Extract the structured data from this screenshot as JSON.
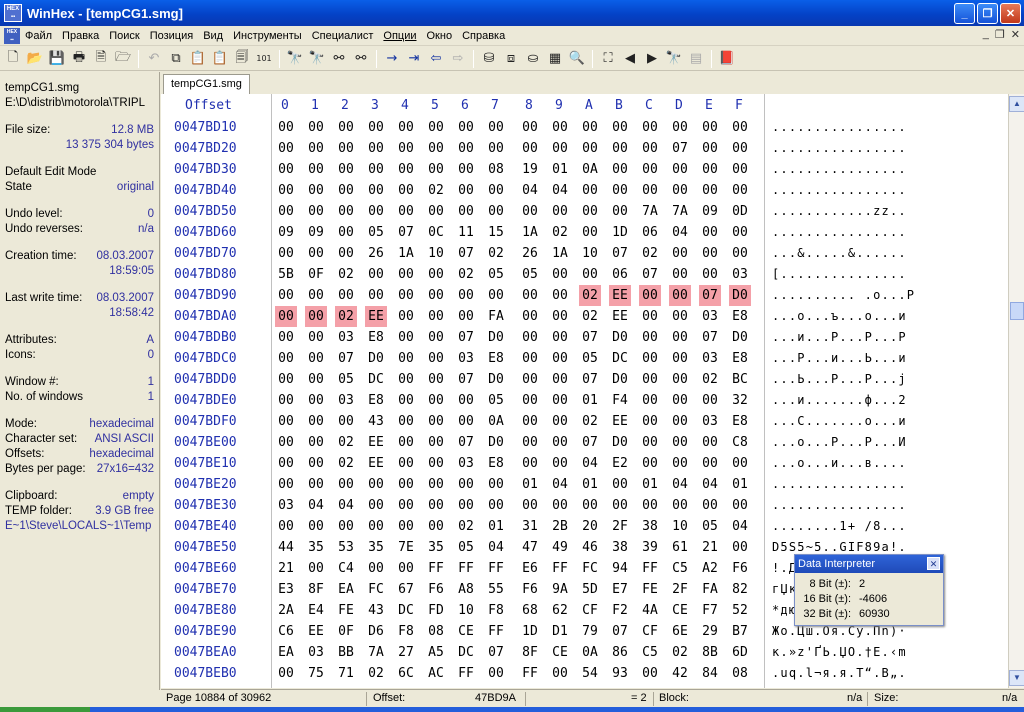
{
  "window": {
    "title": "WinHex - [tempCG1.smg]",
    "icon": "winhex-app-icon",
    "buttons": [
      "minimize",
      "restore",
      "close"
    ]
  },
  "menu": [
    "Файл",
    "Правка",
    "Поиск",
    "Позиция",
    "Вид",
    "Инструменты",
    "Специалист",
    "Опции",
    "Окно",
    "Справка"
  ],
  "sidebar": {
    "filename": "tempCG1.smg",
    "path": "E:\\D\\distrib\\motorola\\TRIPL",
    "file_size_label": "File size:",
    "file_size_mb": "12.8 MB",
    "file_size_bytes": "13 375 304 bytes",
    "edit_mode_label": "Default Edit Mode",
    "state_label": "State",
    "state_value": "original",
    "undo_level_label": "Undo level:",
    "undo_level_value": "0",
    "undo_reverses_label": "Undo reverses:",
    "undo_reverses_value": "n/a",
    "creation_label": "Creation time:",
    "creation_date": "08.03.2007",
    "creation_time": "18:59:05",
    "lastwrite_label": "Last write time:",
    "lastwrite_date": "08.03.2007",
    "lastwrite_time": "18:58:42",
    "attributes_label": "Attributes:",
    "attributes_value": "A",
    "icons_label": "Icons:",
    "icons_value": "0",
    "window_no_label": "Window #:",
    "window_no_value": "1",
    "windows_count_label": "No. of windows",
    "windows_count_value": "1",
    "mode_label": "Mode:",
    "mode_value": "hexadecimal",
    "charset_label": "Character set:",
    "charset_value": "ANSI ASCII",
    "offsets_label": "Offsets:",
    "offsets_value": "hexadecimal",
    "bpp_label": "Bytes per page:",
    "bpp_value": "27x16=432",
    "clipboard_label": "Clipboard:",
    "clipboard_value": "empty",
    "temp_label": "TEMP folder:",
    "temp_value": "3.9 GB free",
    "temp_path": "E~1\\Steve\\LOCALS~1\\Temp"
  },
  "tab": "tempCG1.smg",
  "hex": {
    "offset_header": "Offset",
    "columns": [
      "0",
      "1",
      "2",
      "3",
      "4",
      "5",
      "6",
      "7",
      "8",
      "9",
      "A",
      "B",
      "C",
      "D",
      "E",
      "F"
    ],
    "rows": [
      {
        "offset": "0047BD10",
        "bytes": [
          "00",
          "00",
          "00",
          "00",
          "00",
          "00",
          "00",
          "00",
          "00",
          "00",
          "00",
          "00",
          "00",
          "00",
          "00",
          "00"
        ],
        "ascii": "................"
      },
      {
        "offset": "0047BD20",
        "bytes": [
          "00",
          "00",
          "00",
          "00",
          "00",
          "00",
          "00",
          "00",
          "00",
          "00",
          "00",
          "00",
          "00",
          "07",
          "00",
          "00"
        ],
        "ascii": "................"
      },
      {
        "offset": "0047BD30",
        "bytes": [
          "00",
          "00",
          "00",
          "00",
          "00",
          "00",
          "00",
          "08",
          "19",
          "01",
          "0A",
          "00",
          "00",
          "00",
          "00",
          "00"
        ],
        "ascii": "................"
      },
      {
        "offset": "0047BD40",
        "bytes": [
          "00",
          "00",
          "00",
          "00",
          "00",
          "02",
          "00",
          "00",
          "04",
          "04",
          "00",
          "00",
          "00",
          "00",
          "00",
          "00"
        ],
        "ascii": "................"
      },
      {
        "offset": "0047BD50",
        "bytes": [
          "00",
          "00",
          "00",
          "00",
          "00",
          "00",
          "00",
          "00",
          "00",
          "00",
          "00",
          "00",
          "7A",
          "7A",
          "09",
          "0D"
        ],
        "ascii": "............zz.."
      },
      {
        "offset": "0047BD60",
        "bytes": [
          "09",
          "09",
          "00",
          "05",
          "07",
          "0C",
          "11",
          "15",
          "1A",
          "02",
          "00",
          "1D",
          "06",
          "04",
          "00",
          "00"
        ],
        "ascii": "................"
      },
      {
        "offset": "0047BD70",
        "bytes": [
          "00",
          "00",
          "00",
          "26",
          "1A",
          "10",
          "07",
          "02",
          "26",
          "1A",
          "10",
          "07",
          "02",
          "00",
          "00",
          "00"
        ],
        "ascii": "...&.....&......"
      },
      {
        "offset": "0047BD80",
        "bytes": [
          "5B",
          "0F",
          "02",
          "00",
          "00",
          "00",
          "02",
          "05",
          "05",
          "00",
          "00",
          "06",
          "07",
          "00",
          "00",
          "03"
        ],
        "ascii": "[..............."
      },
      {
        "offset": "0047BD90",
        "bytes": [
          "00",
          "00",
          "00",
          "00",
          "00",
          "00",
          "00",
          "00",
          "00",
          "00",
          "02",
          "EE",
          "00",
          "00",
          "07",
          "D0"
        ],
        "ascii": ".......... .о...Р"
      },
      {
        "offset": "0047BDA0",
        "bytes": [
          "00",
          "00",
          "02",
          "EE",
          "00",
          "00",
          "00",
          "FA",
          "00",
          "00",
          "02",
          "EE",
          "00",
          "00",
          "03",
          "E8"
        ],
        "ascii": "...о...ъ...о...и"
      },
      {
        "offset": "0047BDB0",
        "bytes": [
          "00",
          "00",
          "03",
          "E8",
          "00",
          "00",
          "07",
          "D0",
          "00",
          "00",
          "07",
          "D0",
          "00",
          "00",
          "07",
          "D0"
        ],
        "ascii": "...и...Р...Р...Р"
      },
      {
        "offset": "0047BDC0",
        "bytes": [
          "00",
          "00",
          "07",
          "D0",
          "00",
          "00",
          "03",
          "E8",
          "00",
          "00",
          "05",
          "DC",
          "00",
          "00",
          "03",
          "E8"
        ],
        "ascii": "...Р...и...Ь...и"
      },
      {
        "offset": "0047BDD0",
        "bytes": [
          "00",
          "00",
          "05",
          "DC",
          "00",
          "00",
          "07",
          "D0",
          "00",
          "00",
          "07",
          "D0",
          "00",
          "00",
          "02",
          "BC"
        ],
        "ascii": "...Ь...Р...Р...j"
      },
      {
        "offset": "0047BDE0",
        "bytes": [
          "00",
          "00",
          "03",
          "E8",
          "00",
          "00",
          "00",
          "05",
          "00",
          "00",
          "01",
          "F4",
          "00",
          "00",
          "00",
          "32"
        ],
        "ascii": "...и.......ф...2"
      },
      {
        "offset": "0047BDF0",
        "bytes": [
          "00",
          "00",
          "00",
          "43",
          "00",
          "00",
          "00",
          "0A",
          "00",
          "00",
          "02",
          "EE",
          "00",
          "00",
          "03",
          "E8"
        ],
        "ascii": "...C.......о...и"
      },
      {
        "offset": "0047BE00",
        "bytes": [
          "00",
          "00",
          "02",
          "EE",
          "00",
          "00",
          "07",
          "D0",
          "00",
          "00",
          "07",
          "D0",
          "00",
          "00",
          "00",
          "C8"
        ],
        "ascii": "...о...Р...Р...И"
      },
      {
        "offset": "0047BE10",
        "bytes": [
          "00",
          "00",
          "02",
          "EE",
          "00",
          "00",
          "03",
          "E8",
          "00",
          "00",
          "04",
          "E2",
          "00",
          "00",
          "00",
          "00"
        ],
        "ascii": "...о...и...в...."
      },
      {
        "offset": "0047BE20",
        "bytes": [
          "00",
          "00",
          "00",
          "00",
          "00",
          "00",
          "00",
          "00",
          "01",
          "04",
          "01",
          "00",
          "01",
          "04",
          "04",
          "01"
        ],
        "ascii": "................"
      },
      {
        "offset": "0047BE30",
        "bytes": [
          "03",
          "04",
          "04",
          "00",
          "00",
          "00",
          "00",
          "00",
          "00",
          "00",
          "00",
          "00",
          "00",
          "00",
          "00",
          "00"
        ],
        "ascii": "................"
      },
      {
        "offset": "0047BE40",
        "bytes": [
          "00",
          "00",
          "00",
          "00",
          "00",
          "00",
          "02",
          "01",
          "31",
          "2B",
          "20",
          "2F",
          "38",
          "10",
          "05",
          "04"
        ],
        "ascii": "........1+ /8..."
      },
      {
        "offset": "0047BE50",
        "bytes": [
          "44",
          "35",
          "53",
          "35",
          "7E",
          "35",
          "05",
          "04",
          "47",
          "49",
          "46",
          "38",
          "39",
          "61",
          "21",
          "00"
        ],
        "ascii": "D5S5~5..GIF89a!."
      },
      {
        "offset": "0047BE60",
        "bytes": [
          "21",
          "00",
          "C4",
          "00",
          "00",
          "FF",
          "FF",
          "FF",
          "E6",
          "FF",
          "FC",
          "94",
          "FF",
          "C5",
          "A2",
          "F6"
        ],
        "ascii": "!.Д..яяяжяь”яЕўц"
      },
      {
        "offset": "0047BE70",
        "bytes": [
          "E3",
          "8F",
          "EA",
          "FC",
          "67",
          "F6",
          "A8",
          "55",
          "F6",
          "9A",
          "5D",
          "E7",
          "FE",
          "2F",
          "FA",
          "82"
        ],
        "ascii": "гЏкьgцЁUцљ]зю/ъ‚"
      },
      {
        "offset": "0047BE80",
        "bytes": [
          "2A",
          "E4",
          "FE",
          "43",
          "DC",
          "FD",
          "10",
          "F8",
          "68",
          "62",
          "CF",
          "F2",
          "4A",
          "CE",
          "F7",
          "52"
        ],
        "ascii": "*дюCЬэ.шhbПтJОчR"
      },
      {
        "offset": "0047BE90",
        "bytes": [
          "C6",
          "EE",
          "0F",
          "D6",
          "F8",
          "08",
          "CE",
          "FF",
          "1D",
          "D1",
          "79",
          "07",
          "CF",
          "6E",
          "29",
          "B7"
        ],
        "ascii": "Жо.Цш.Оя.Сy.Пn)·"
      },
      {
        "offset": "0047BEA0",
        "bytes": [
          "EA",
          "03",
          "BB",
          "7A",
          "27",
          "A5",
          "DC",
          "07",
          "8F",
          "CE",
          "0A",
          "86",
          "C5",
          "02",
          "8B",
          "6D"
        ],
        "ascii": "к.»z'ҐЬ.ЏО.†Е.‹m"
      },
      {
        "offset": "0047BEB0",
        "bytes": [
          "00",
          "75",
          "71",
          "02",
          "6C",
          "AC",
          "FF",
          "00",
          "FF",
          "00",
          "54",
          "93",
          "00",
          "42",
          "84",
          "08"
        ],
        "ascii": ".uq.l¬я.я.T“.B„."
      }
    ]
  },
  "status": {
    "page": "Page 10884 of 30962",
    "offset_label": "Offset:",
    "offset_value": "47BD9A",
    "equals": "= 2",
    "block_label": "Block:",
    "block_value": "n/a",
    "size_label": "Size:",
    "size_value": "n/a"
  },
  "data_interpreter": {
    "title": "Data Interpreter",
    "rows": [
      {
        "label": "8 Bit (±):",
        "value": "2"
      },
      {
        "label": "16 Bit (±):",
        "value": "-4606"
      },
      {
        "label": "32 Bit (±):",
        "value": "60930"
      }
    ]
  }
}
